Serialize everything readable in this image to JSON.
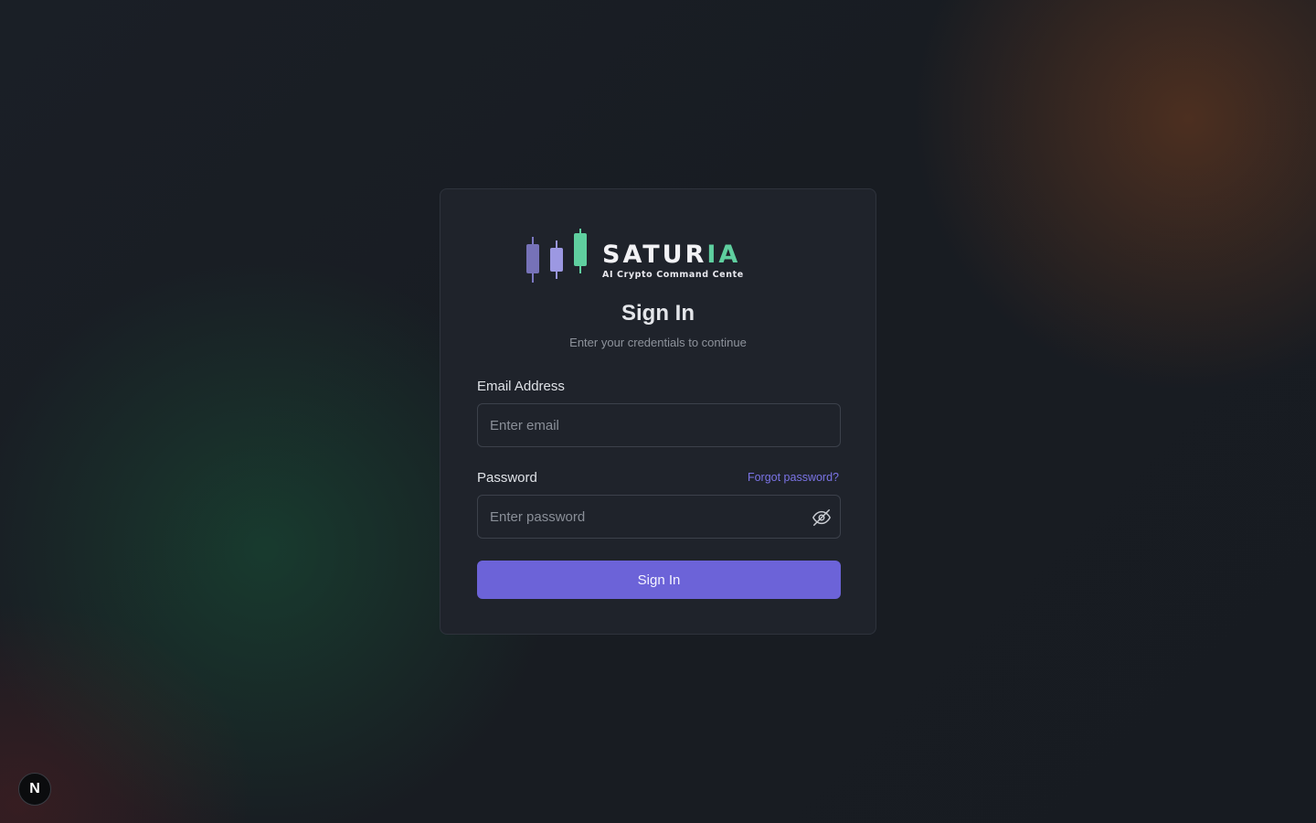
{
  "brand": {
    "name_part1": "SATUR",
    "name_part2": "IA",
    "tagline": "AI Crypto Command Center",
    "accent_color": "#5fcf9f",
    "candle_color": "#8a86d6",
    "icon": "candlestick-logo-icon"
  },
  "heading": {
    "title": "Sign In",
    "subtitle": "Enter your credentials to continue"
  },
  "form": {
    "email_label": "Email Address",
    "email_placeholder": "Enter email",
    "email_value": "",
    "password_label": "Password",
    "password_placeholder": "Enter password",
    "password_value": "",
    "forgot_link": "Forgot password?",
    "toggle_icon": "eye-off-icon",
    "submit_label": "Sign In"
  },
  "dev_badge": {
    "label": "N",
    "icon": "nextjs-icon"
  },
  "colors": {
    "primary": "#6c63d8",
    "link": "#7b74e6",
    "card_bg": "#1f232b",
    "page_bg": "#181c23"
  }
}
